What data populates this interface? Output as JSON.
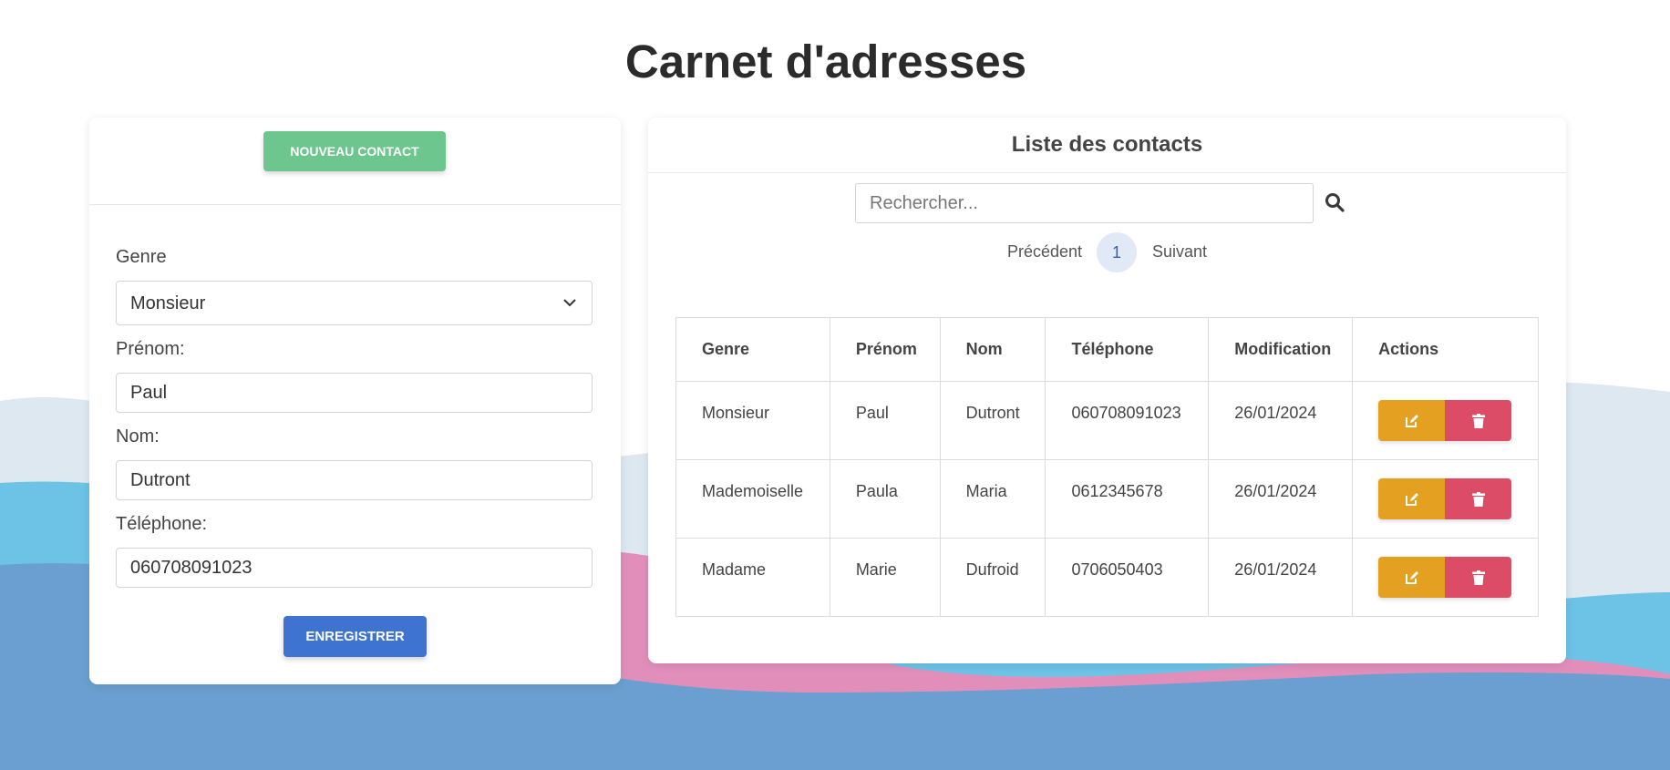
{
  "page": {
    "title": "Carnet d'adresses"
  },
  "colors": {
    "new_contact_button": "#6cc68e",
    "save_button": "#3f73d1",
    "edit_button": "#e4a020",
    "delete_button": "#dc4c67",
    "wave_light": "#dde8f0",
    "wave_cyan": "#6cc3e6",
    "wave_pink": "#e18fba",
    "wave_blue": "#6b9fd1"
  },
  "form": {
    "new_contact_label": "NOUVEAU CONTACT",
    "genre_label": "Genre",
    "genre_value": "Monsieur",
    "prenom_label": "Prénom:",
    "prenom_value": "Paul",
    "nom_label": "Nom:",
    "nom_value": "Dutront",
    "telephone_label": "Téléphone:",
    "telephone_value": "060708091023",
    "save_label": "ENREGISTRER"
  },
  "list": {
    "title": "Liste des contacts",
    "search_placeholder": "Rechercher...",
    "pagination": {
      "previous": "Précédent",
      "current_page": "1",
      "next": "Suivant"
    },
    "columns": [
      "Genre",
      "Prénom",
      "Nom",
      "Téléphone",
      "Modification",
      "Actions"
    ],
    "rows": [
      {
        "genre": "Monsieur",
        "prenom": "Paul",
        "nom": "Dutront",
        "telephone": "060708091023",
        "modification": "26/01/2024"
      },
      {
        "genre": "Mademoiselle",
        "prenom": "Paula",
        "nom": "Maria",
        "telephone": "0612345678",
        "modification": "26/01/2024"
      },
      {
        "genre": "Madame",
        "prenom": "Marie",
        "nom": "Dufroid",
        "telephone": "0706050403",
        "modification": "26/01/2024"
      }
    ]
  }
}
